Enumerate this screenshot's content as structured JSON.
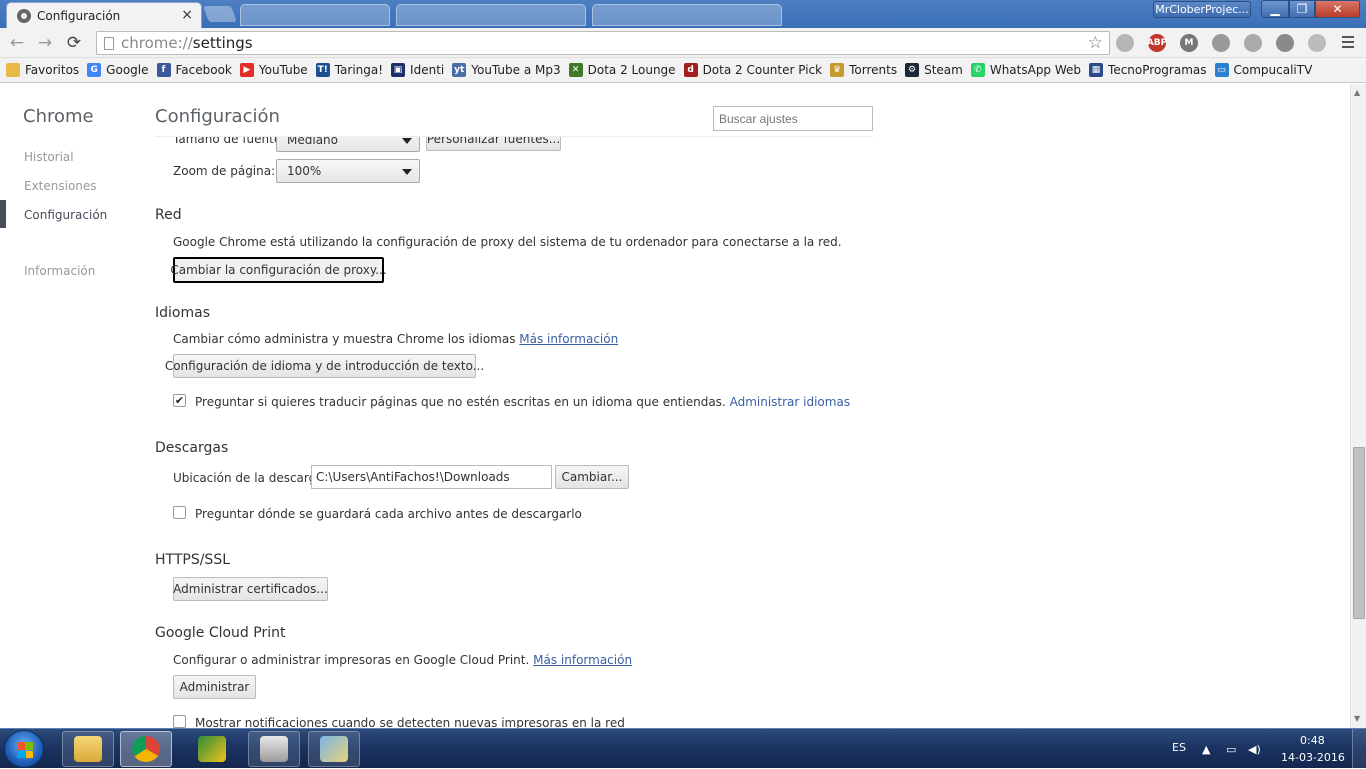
{
  "window": {
    "tab_title": "Configuración",
    "tab_close": "×",
    "profile": "MrCloberProjec...",
    "minimize": "▁",
    "maximize": "❐",
    "close": "✕"
  },
  "toolbar": {
    "url_scheme": "chrome://",
    "url_path": "settings",
    "star": "☆"
  },
  "extensions": [
    {
      "label": "",
      "color": "#b5b5b5"
    },
    {
      "label": "ABP",
      "color": "#c0392b"
    },
    {
      "label": "M",
      "color": "#777777"
    },
    {
      "label": "",
      "color": "#999999"
    },
    {
      "label": "",
      "color": "#aaaaaa"
    },
    {
      "label": "",
      "color": "#8a8a8a"
    },
    {
      "label": "",
      "color": "#bbbbbb"
    }
  ],
  "bookmarks": [
    {
      "label": "Favoritos",
      "icon": "folder-icon",
      "color": "#e8b84a",
      "glyph": ""
    },
    {
      "label": "Google",
      "icon": "google-icon",
      "color": "#4285f4",
      "glyph": "G"
    },
    {
      "label": "Facebook",
      "icon": "facebook-icon",
      "color": "#3b5998",
      "glyph": "f"
    },
    {
      "label": "YouTube",
      "icon": "youtube-icon",
      "color": "#e52d27",
      "glyph": "▶"
    },
    {
      "label": "Taringa!",
      "icon": "taringa-icon",
      "color": "#1d4f91",
      "glyph": "T!"
    },
    {
      "label": "Identi",
      "icon": "identi-icon",
      "color": "#1a2f6b",
      "glyph": "▣"
    },
    {
      "label": "YouTube a Mp3",
      "icon": "mp3-icon",
      "color": "#4a6fa5",
      "glyph": "yt"
    },
    {
      "label": "Dota 2 Lounge",
      "icon": "dota-lounge-icon",
      "color": "#3e7a28",
      "glyph": "✕"
    },
    {
      "label": "Dota 2 Counter Pick",
      "icon": "dota-counter-icon",
      "color": "#a02020",
      "glyph": "d"
    },
    {
      "label": "Torrents",
      "icon": "torrents-icon",
      "color": "#c59a2e",
      "glyph": "♛"
    },
    {
      "label": "Steam",
      "icon": "steam-icon",
      "color": "#1b2838",
      "glyph": "⚙"
    },
    {
      "label": "WhatsApp Web",
      "icon": "whatsapp-icon",
      "color": "#25d366",
      "glyph": "✆"
    },
    {
      "label": "TecnoProgramas",
      "icon": "tecnoprogramas-icon",
      "color": "#2a4a8a",
      "glyph": "▦"
    },
    {
      "label": "CompucaliTV",
      "icon": "compucalitv-icon",
      "color": "#2d7fd1",
      "glyph": "▭"
    }
  ],
  "sidebar": {
    "title": "Chrome",
    "items": [
      {
        "label": "Historial"
      },
      {
        "label": "Extensiones"
      },
      {
        "label": "Configuración"
      },
      {
        "label": "Información"
      }
    ]
  },
  "header": {
    "title": "Configuración",
    "search_placeholder": "Buscar ajustes"
  },
  "fonts": {
    "size_label": "Tamaño de fuente:",
    "size_value": "Mediano",
    "customize_button": "Personalizar fuentes...",
    "zoom_label": "Zoom de página:",
    "zoom_value": "100%"
  },
  "network": {
    "title": "Red",
    "description": "Google Chrome está utilizando la configuración de proxy del sistema de tu ordenador para conectarse a la red.",
    "proxy_button": "Cambiar la configuración de proxy..."
  },
  "languages": {
    "title": "Idiomas",
    "description": "Cambiar cómo administra y muestra Chrome los idiomas",
    "more_info": "Más información",
    "settings_button": "Configuración de idioma y de introducción de texto...",
    "translate_label": "Preguntar si quieres traducir páginas que no estén escritas en un idioma que entiendas.",
    "translate_checked": "✔",
    "manage_link": "Administrar idiomas"
  },
  "downloads": {
    "title": "Descargas",
    "location_label": "Ubicación de la descarga:",
    "location_value": "C:\\Users\\AntiFachos!\\Downloads",
    "change_button": "Cambiar...",
    "ask_label": "Preguntar dónde se guardará cada archivo antes de descargarlo"
  },
  "https": {
    "title": "HTTPS/SSL",
    "certificates_button": "Administrar certificados..."
  },
  "cloud_print": {
    "title": "Google Cloud Print",
    "description": "Configurar o administrar impresoras en Google Cloud Print.",
    "more_info": "Más información",
    "manage_button": "Administrar",
    "notify_label": "Mostrar notificaciones cuando se detecten nuevas impresoras en la red"
  },
  "taskbar": {
    "language": "ES",
    "time": "0:48",
    "date": "14-03-2016"
  }
}
